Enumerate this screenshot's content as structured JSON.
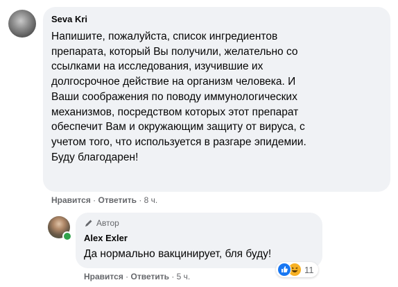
{
  "comment": {
    "author": "Seva Kri",
    "lines": [
      "Напишите, пожалуйста, список ингредиентов",
      "препарата, который Вы получили, желательно со",
      "ссылками на исследования, изучившие их",
      "долгосрочное действие на организм человека. И",
      "Ваши соображения по поводу иммунологических",
      "механизмов, посредством которых этот препарат",
      "обеспечит Вам и окружающим защиту от вируса, с",
      "учетом того, что используется в разгаре эпидемии.",
      "Буду благодарен!"
    ],
    "like_label": "Нравится",
    "reply_label": "Ответить",
    "sep": "·",
    "time": "8 ч."
  },
  "reply": {
    "badge_label": "Автор",
    "author": "Alex Exler",
    "text": "Да нормально вакцинирует, бля буду!",
    "reaction_count": "11",
    "reaction_icons": [
      "like-icon",
      "haha-icon"
    ],
    "like_label": "Нравится",
    "reply_label": "Ответить",
    "sep": "·",
    "time": "5 ч."
  },
  "colors": {
    "bubble": "#f0f2f5",
    "secondary_text": "#65676b",
    "like": "#1877f2",
    "online": "#31a24c"
  }
}
